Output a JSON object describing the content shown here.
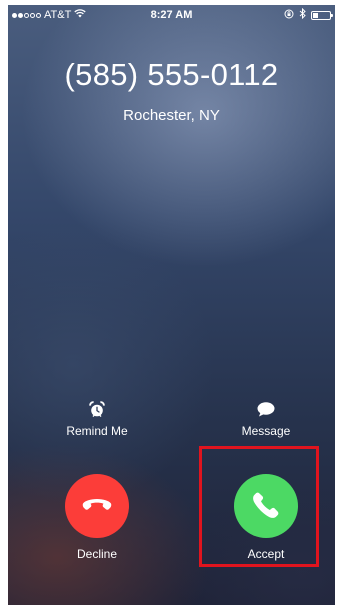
{
  "status_bar": {
    "carrier": "AT&T",
    "time": "8:27 AM",
    "signal_bars_filled": 2,
    "signal_bars_total": 5,
    "icons": [
      "wifi-icon",
      "orientation-lock-icon",
      "bluetooth-icon",
      "battery-icon"
    ]
  },
  "caller": {
    "number": "(585) 555-0112",
    "location": "Rochester, NY"
  },
  "actions": {
    "remind_me": {
      "label": "Remind Me",
      "icon": "alarm-clock-icon"
    },
    "message": {
      "label": "Message",
      "icon": "speech-bubble-icon"
    },
    "decline": {
      "label": "Decline",
      "icon": "phone-hangup-icon",
      "color": "#fc3d39"
    },
    "accept": {
      "label": "Accept",
      "icon": "phone-icon",
      "color": "#4cd964"
    }
  },
  "highlight": {
    "target": "accept",
    "color": "#e0141e"
  }
}
